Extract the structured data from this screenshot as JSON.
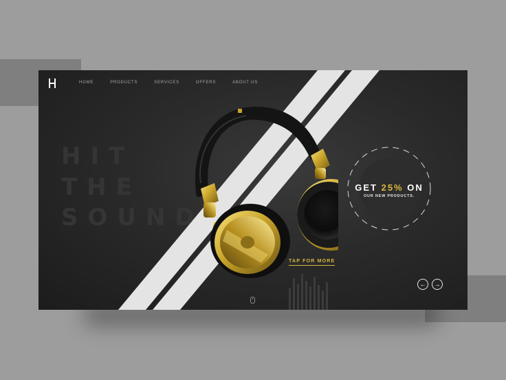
{
  "nav": {
    "logo": "logo-mark",
    "items": [
      "HOME",
      "PRODUCTS",
      "SERVICES",
      "OFFERS",
      "ABOUT US"
    ]
  },
  "hero": {
    "headline_lines": [
      "HIT",
      "THE",
      "SOUND"
    ],
    "offer": {
      "title_prefix": "GET",
      "title_accent": "25%",
      "title_suffix": "ON",
      "subtitle": "OUR NEW PRODUCTS."
    },
    "cta_label": "TAP FOR MORE"
  },
  "slider": {
    "prev_icon": "arrow-left-icon",
    "next_icon": "arrow-right-icon"
  },
  "colors": {
    "accent": "#d9b740",
    "hero_bg": "#262626",
    "page_bg": "#9d9d9d",
    "stripe": "#e4e4e4"
  }
}
